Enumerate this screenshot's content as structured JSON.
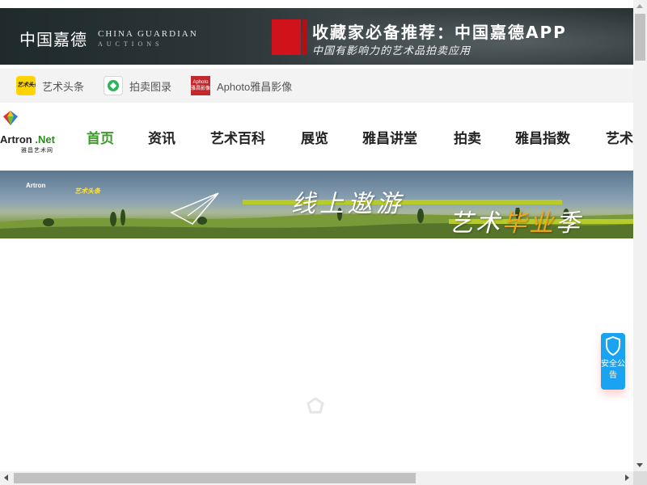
{
  "ad_banner": {
    "logo_cn": "中国嘉德",
    "logo_en": "CHINA GUARDIAN",
    "logo_sub": "AUCTIONS",
    "headline": "收藏家必备推荐：中国嘉德APP",
    "subline": "中国有影响力的艺术品拍卖应用"
  },
  "app_links": [
    {
      "label": "艺术头条",
      "icon_text": "艺术头条",
      "icon": "yishu-toutiao-icon"
    },
    {
      "label": "拍卖图录",
      "icon": "paimai-tulu-icon"
    },
    {
      "label": "Aphoto雅昌影像",
      "icon_text": "Aphoto 雅昌影像",
      "icon": "aphoto-icon"
    }
  ],
  "logo": {
    "brand": "Artron",
    "net": ".Net",
    "tagline": "雅昌艺术网"
  },
  "nav": {
    "items": [
      "首页",
      "资讯",
      "艺术百科",
      "展览",
      "雅昌讲堂",
      "拍卖",
      "雅昌指数",
      "艺术"
    ],
    "active_index": 0
  },
  "hero": {
    "mini_logo": "Artron",
    "mini_yitou": "艺术头条",
    "line1": "线上遨游",
    "line2_a": "艺术",
    "line2_b": "毕业",
    "line2_c": "季"
  },
  "security_notice": {
    "label": "安全公告"
  },
  "colors": {
    "nav_active": "#3e9a2c",
    "notice_blue": "#1aa3f0",
    "ad_red": "#d0121b"
  }
}
